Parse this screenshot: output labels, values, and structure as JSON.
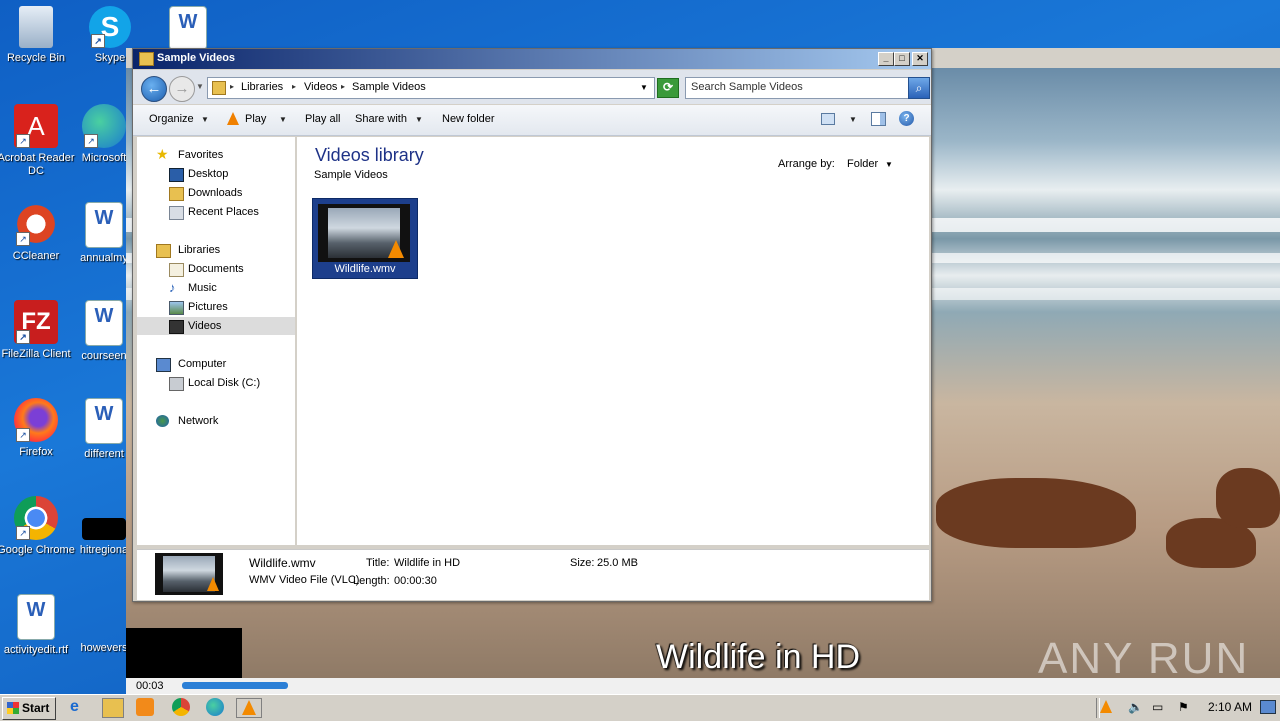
{
  "desktop": {
    "icons": [
      {
        "label": "Recycle Bin"
      },
      {
        "label": "Skype"
      },
      {
        "label": "Acrobat Reader DC"
      },
      {
        "label": "Microsoft"
      },
      {
        "label": "CCleaner"
      },
      {
        "label": "annualmy"
      },
      {
        "label": "FileZilla Client"
      },
      {
        "label": "courseen"
      },
      {
        "label": "Firefox"
      },
      {
        "label": "different"
      },
      {
        "label": "Google Chrome"
      },
      {
        "label": "hitregiona"
      },
      {
        "label": "activityedit.rtf"
      },
      {
        "label": "howevers"
      }
    ]
  },
  "vlc": {
    "subtitle": "Wildlife in HD",
    "watermark": "ANY RUN",
    "elapsed": "00:03",
    "progress_fraction": 0.1
  },
  "explorer": {
    "title": "Sample Videos",
    "window_buttons": {
      "minimize": "_",
      "maximize": "□",
      "close": "✕"
    },
    "breadcrumb": [
      "Libraries",
      "Videos",
      "Sample Videos"
    ],
    "search_placeholder": "Search Sample Videos",
    "toolbar": {
      "organize": "Organize",
      "play": "Play",
      "play_all": "Play all",
      "share_with": "Share with",
      "new_folder": "New folder"
    },
    "nav": {
      "favorites": "Favorites",
      "desktop": "Desktop",
      "downloads": "Downloads",
      "recent_places": "Recent Places",
      "libraries": "Libraries",
      "documents": "Documents",
      "music": "Music",
      "pictures": "Pictures",
      "videos": "Videos",
      "computer": "Computer",
      "local_disk": "Local Disk (C:)",
      "network": "Network"
    },
    "content": {
      "library_title": "Videos library",
      "library_subtitle": "Sample Videos",
      "arrange_label": "Arrange by:",
      "arrange_value": "Folder",
      "file_name": "Wildlife.wmv"
    },
    "details": {
      "name": "Wildlife.wmv",
      "type": "WMV Video File (VLC)",
      "title_label": "Title:",
      "title_value": "Wildlife in HD",
      "length_label": "Length:",
      "length_value": "00:00:30",
      "size_label": "Size:",
      "size_value": "25.0 MB"
    }
  },
  "taskbar": {
    "start": "Start",
    "clock": "2:10 AM"
  }
}
